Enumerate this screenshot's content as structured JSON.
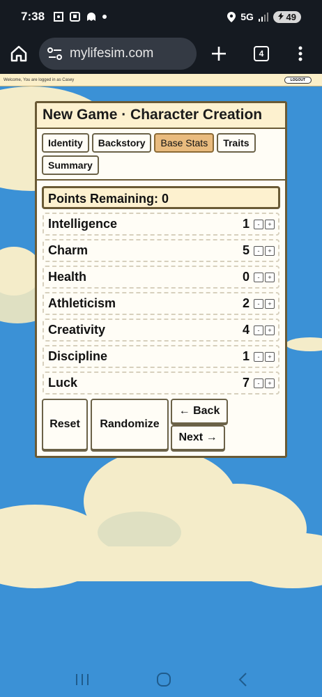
{
  "status_bar": {
    "time": "7:38",
    "network": "5G",
    "battery": "49",
    "icons": [
      "screenshot-icon",
      "app-icon",
      "ghost-icon",
      "dot-icon",
      "location-icon",
      "signal-icon",
      "charging-icon"
    ]
  },
  "browser": {
    "url": "mylifesim.com",
    "tab_count": "4"
  },
  "site_header": {
    "welcome": "Welcome, You are logged in as Casey",
    "logout_label": "LOGOUT"
  },
  "panel": {
    "title": "New Game · Character Creation",
    "tabs": [
      {
        "label": "Identity",
        "active": false
      },
      {
        "label": "Backstory",
        "active": false
      },
      {
        "label": "Base Stats",
        "active": true
      },
      {
        "label": "Traits",
        "active": false
      },
      {
        "label": "Summary",
        "active": false
      }
    ],
    "points_remaining": "Points Remaining: 0",
    "stats": [
      {
        "name": "Intelligence",
        "value": "1"
      },
      {
        "name": "Charm",
        "value": "5"
      },
      {
        "name": "Health",
        "value": "0"
      },
      {
        "name": "Athleticism",
        "value": "2"
      },
      {
        "name": "Creativity",
        "value": "4"
      },
      {
        "name": "Discipline",
        "value": "1"
      },
      {
        "name": "Luck",
        "value": "7"
      }
    ],
    "stepper": {
      "minus": "-",
      "plus": "+"
    },
    "actions": {
      "reset": "Reset",
      "randomize": "Randomize",
      "back": "← Back",
      "next": "Next →"
    }
  },
  "colors": {
    "sky": "#3b91d6",
    "cloud": "#f4ecc9",
    "panel_header": "#fdf1cf",
    "active_tab": "#e9bb7e",
    "border": "#6a5a35"
  }
}
